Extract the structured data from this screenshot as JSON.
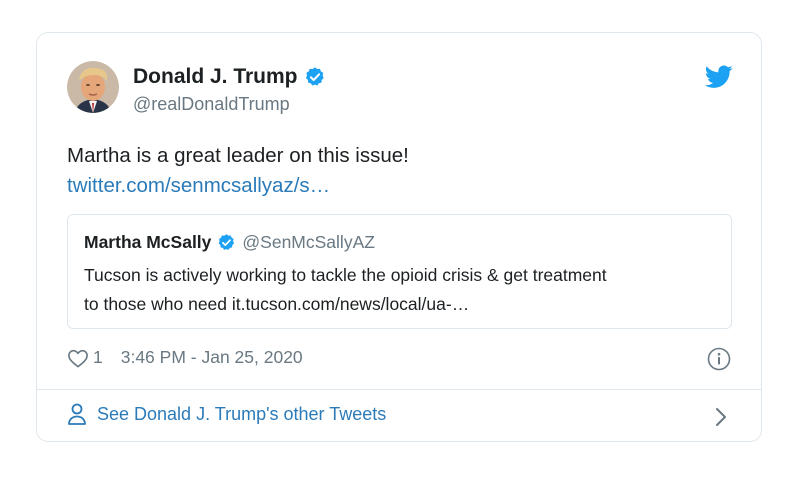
{
  "tweet": {
    "author_name": "Donald J. Trump",
    "author_handle": "@realDonaldTrump",
    "text": "Martha is a great leader on this issue!",
    "link": "twitter.com/senmcsallyaz/s…",
    "likes": "1",
    "timestamp": "3:46 PM - Jan 25, 2020"
  },
  "quoted": {
    "author_name": "Martha McSally",
    "author_handle": "@SenMcSallyAZ",
    "text_line1": "Tucson is actively working to tackle the opioid crisis & get treatment",
    "text_line2": "to those who need it.tucson.com/news/local/ua-…"
  },
  "footer": {
    "label": "See Donald J. Trump's other Tweets"
  },
  "icons": {
    "verified": "verified-badge-icon",
    "brand": "twitter-bird-icon",
    "like": "heart-icon",
    "info": "info-icon",
    "profile": "person-icon",
    "chevron": "chevron-right-icon"
  },
  "colors": {
    "brand_blue": "#1da1f2",
    "link_blue": "#2b7bb9",
    "secondary_text": "#697882",
    "border": "#e1e8ed"
  }
}
